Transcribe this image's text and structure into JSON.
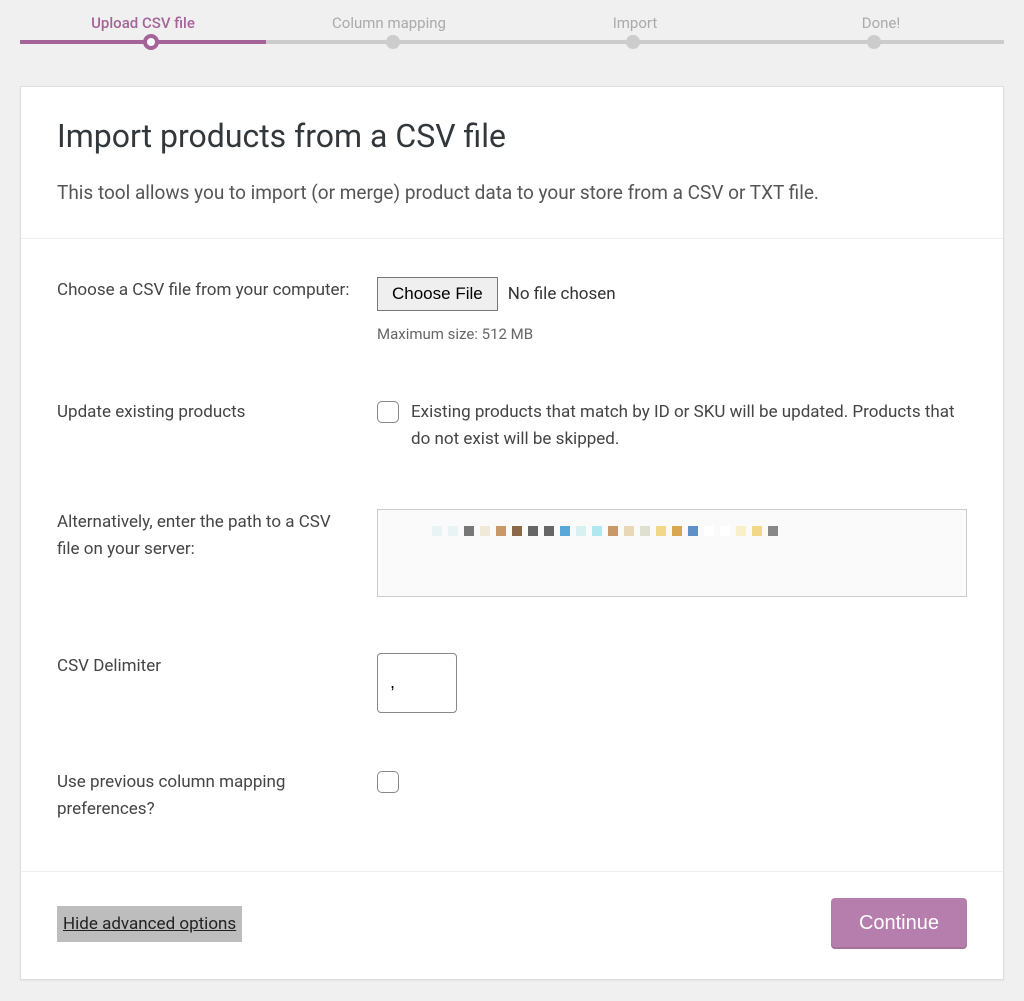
{
  "stepper": {
    "steps": [
      "Upload CSV file",
      "Column mapping",
      "Import",
      "Done!"
    ],
    "active_index": 0
  },
  "header": {
    "title": "Import products from a CSV file",
    "subtitle": "This tool allows you to import (or merge) product data to your store from a CSV or TXT file."
  },
  "form": {
    "choose_file": {
      "label": "Choose a CSV file from your computer:",
      "button": "Choose File",
      "status": "No file chosen",
      "hint": "Maximum size: 512 MB"
    },
    "update_existing": {
      "label": "Update existing products",
      "description": "Existing products that match by ID or SKU will be updated. Products that do not exist will be skipped.",
      "checked": false
    },
    "server_path": {
      "label": "Alternatively, enter the path to a CSV file on your server:",
      "value": ""
    },
    "delimiter": {
      "label": "CSV Delimiter",
      "value": ","
    },
    "previous_mapping": {
      "label": "Use previous column mapping preferences?",
      "checked": false
    }
  },
  "actions": {
    "toggle_advanced": "Hide advanced options",
    "continue": "Continue"
  },
  "redacted_colors": [
    "#e8f3f3",
    "#e8f3f3",
    "#777",
    "#f0e8d8",
    "#c89868",
    "#8a6848",
    "#666",
    "#666",
    "#5aa8d8",
    "#d8f0f0",
    "#b0e8f0",
    "#c89868",
    "#e8d8b8",
    "#e0e0d0",
    "#f0d888",
    "#d8a850",
    "#6090c8",
    "#fff",
    "#fff",
    "#f8f0c8",
    "#f0d888",
    "#888"
  ]
}
